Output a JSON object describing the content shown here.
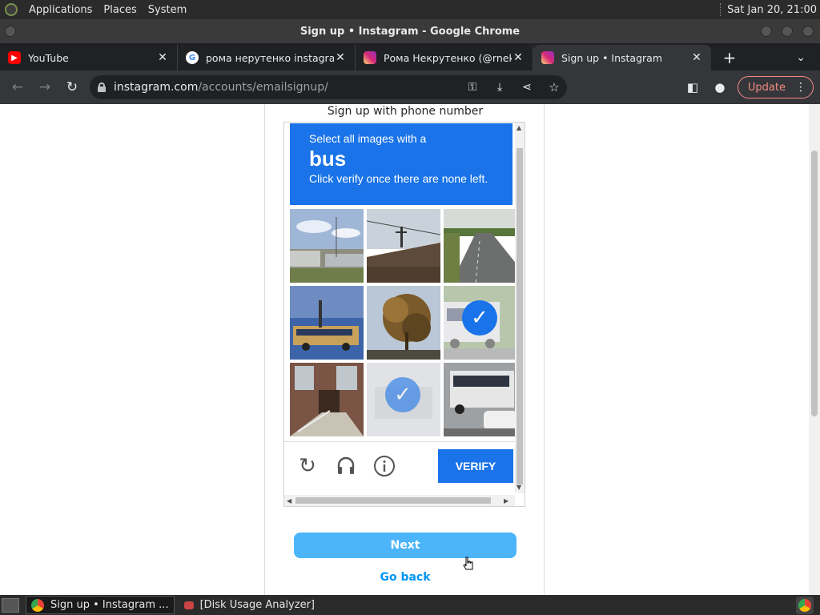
{
  "panel": {
    "applications": "Applications",
    "places": "Places",
    "system": "System",
    "clock": "Sat Jan 20, 21:00"
  },
  "window": {
    "title": "Sign up • Instagram - Google Chrome"
  },
  "tabs": [
    {
      "label": "YouTube",
      "favicon": "youtube-icon"
    },
    {
      "label": "рома нерутенко instagram",
      "favicon": "google-icon"
    },
    {
      "label": "Рома Некрутенко (@rneko",
      "favicon": "instagram-icon"
    },
    {
      "label": "Sign up • Instagram",
      "favicon": "instagram-icon",
      "active": true
    }
  ],
  "toolbar": {
    "url_host": "instagram.com",
    "url_path": "/accounts/emailsignup/",
    "update_label": "Update"
  },
  "page": {
    "signup_phone": "Sign up with phone number",
    "next_label": "Next",
    "go_back_label": "Go back"
  },
  "captcha": {
    "line1": "Select all images with a",
    "object": "bus",
    "line3": "Click verify once there are none left.",
    "verify_label": "VERIFY",
    "tiles": [
      {
        "desc": "industrial buildings",
        "selected": false
      },
      {
        "desc": "roof with antenna",
        "selected": false
      },
      {
        "desc": "highway road",
        "selected": false
      },
      {
        "desc": "school bus",
        "selected": false
      },
      {
        "desc": "autumn tree",
        "selected": false
      },
      {
        "desc": "city bus",
        "selected": true
      },
      {
        "desc": "house with stairs",
        "selected": false
      },
      {
        "desc": "faded tile",
        "selected": true
      },
      {
        "desc": "bus in parking lot",
        "selected": false
      }
    ],
    "accent": "#1a73e8"
  },
  "taskbar": {
    "items": [
      {
        "label": "Sign up • Instagram ...",
        "active": true
      },
      {
        "label": "[Disk Usage Analyzer]",
        "active": false
      }
    ]
  }
}
